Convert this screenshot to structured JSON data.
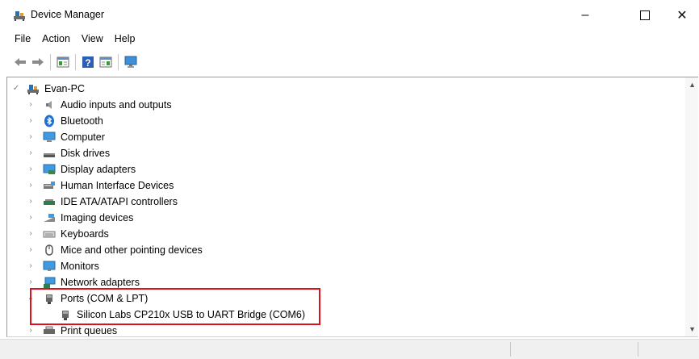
{
  "window": {
    "title": "Device Manager"
  },
  "menu": [
    "File",
    "Action",
    "View",
    "Help"
  ],
  "toolbar": [
    "back-icon",
    "forward-icon",
    "properties-icon",
    "help-icon",
    "update-driver-icon",
    "monitor-icon"
  ],
  "tree": {
    "root": {
      "label": "Evan-PC",
      "expanded": true
    },
    "categories": [
      {
        "label": "Audio inputs and outputs",
        "icon": "speaker-icon"
      },
      {
        "label": "Bluetooth",
        "icon": "bluetooth-icon"
      },
      {
        "label": "Computer",
        "icon": "computer-icon"
      },
      {
        "label": "Disk drives",
        "icon": "disk-drive-icon"
      },
      {
        "label": "Display adapters",
        "icon": "display-adapter-icon"
      },
      {
        "label": "Human Interface Devices",
        "icon": "hid-icon"
      },
      {
        "label": "IDE ATA/ATAPI controllers",
        "icon": "ide-controller-icon"
      },
      {
        "label": "Imaging devices",
        "icon": "camera-icon"
      },
      {
        "label": "Keyboards",
        "icon": "keyboard-icon"
      },
      {
        "label": "Mice and other pointing devices",
        "icon": "mouse-icon"
      },
      {
        "label": "Monitors",
        "icon": "monitor-icon"
      },
      {
        "label": "Network adapters",
        "icon": "network-adapter-icon"
      },
      {
        "label": "Ports (COM & LPT)",
        "icon": "port-icon",
        "expanded": true,
        "children": [
          {
            "label": "Silicon Labs CP210x USB to UART Bridge (COM6)",
            "icon": "port-icon"
          }
        ]
      },
      {
        "label": "Print queues",
        "icon": "printer-icon"
      }
    ]
  },
  "colors": {
    "highlight_border": "#e0101a",
    "accent": "#1e73be"
  }
}
